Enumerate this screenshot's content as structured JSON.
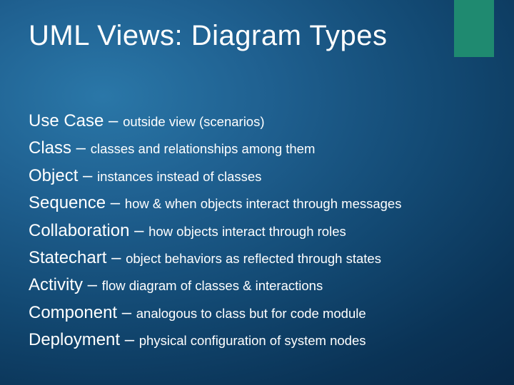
{
  "title": "UML Views: Diagram Types",
  "items": [
    {
      "term": "Use Case",
      "sep": " – ",
      "desc": "outside view (scenarios)"
    },
    {
      "term": "Class",
      "sep": " – ",
      "desc": "classes and relationships among them"
    },
    {
      "term": "Object",
      "sep": " – ",
      "desc": "instances instead of classes"
    },
    {
      "term": "Sequence",
      "sep": " – ",
      "desc": "how & when objects interact through messages"
    },
    {
      "term": "Collaboration",
      "sep": " – ",
      "desc": "how objects interact through roles"
    },
    {
      "term": "Statechart",
      "sep": " – ",
      "desc": "object behaviors as reflected through states"
    },
    {
      "term": "Activity",
      "sep": " – ",
      "desc": "flow diagram of classes & interactions"
    },
    {
      "term": "Component",
      "sep": " – ",
      "desc": "analogous to class but for code module"
    },
    {
      "term": "Deployment",
      "sep": " – ",
      "desc": "physical configuration of system nodes"
    }
  ]
}
